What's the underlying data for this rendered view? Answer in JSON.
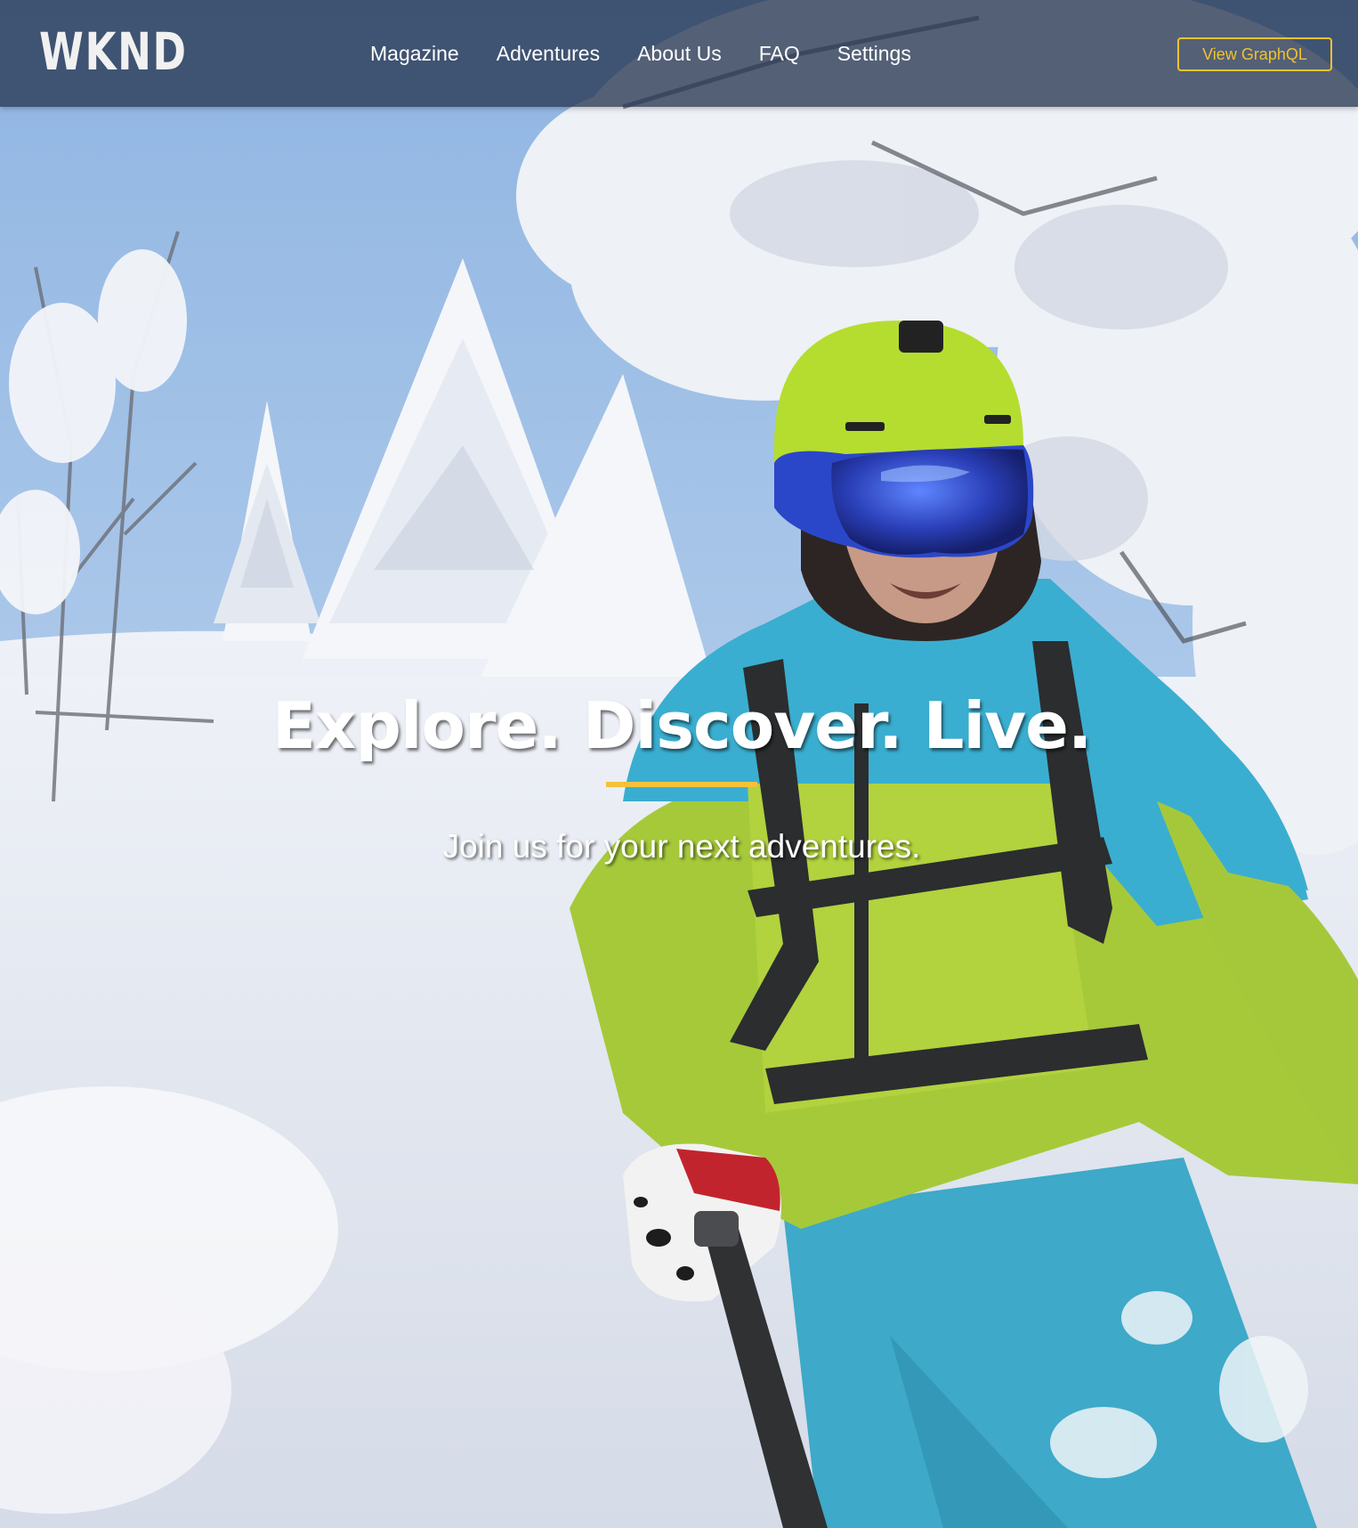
{
  "header": {
    "logo": "WKND",
    "nav": [
      {
        "label": "Magazine"
      },
      {
        "label": "Adventures"
      },
      {
        "label": "About Us"
      },
      {
        "label": "FAQ"
      },
      {
        "label": "Settings"
      }
    ],
    "graphql_button": "View GraphQL"
  },
  "hero": {
    "title": "Explore. Discover. Live.",
    "subtitle": "Join us for your next adventures.",
    "background_image": "skier-in-snowy-forest"
  },
  "colors": {
    "header_bg": "#283752",
    "accent": "#f0c230",
    "text": "#ffffff"
  }
}
